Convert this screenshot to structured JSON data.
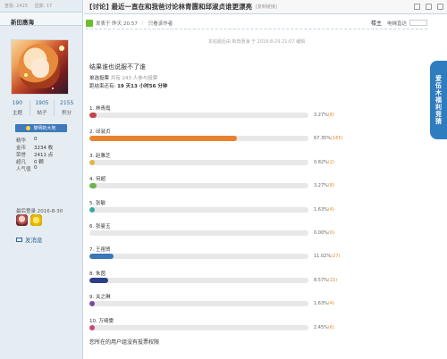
{
  "left_header": {
    "views_label": "查看: 2425",
    "replies_label": "回复: 17"
  },
  "user": {
    "name": "新田惠海",
    "stats": [
      {
        "value": "190",
        "label": "主题"
      },
      {
        "value": "1905",
        "label": "帖子"
      },
      {
        "value": "2155",
        "label": "积分"
      }
    ],
    "badge": "黎明的大地",
    "info": [
      {
        "key": "精华",
        "value": "0"
      },
      {
        "key": "金币",
        "value": "3234 枚"
      },
      {
        "key": "荣誉",
        "value": "2411 点"
      },
      {
        "key": "超凡",
        "value": "0 颗"
      },
      {
        "key": "人气值",
        "value": "0"
      }
    ],
    "last_visit": "最后登录  2016-8-30",
    "pm_label": "发消息"
  },
  "thread": {
    "title": "[讨论] 最近一直在和我爸讨论林青霞和邱淑贞谁更漂亮",
    "copy_link": "[复制链接]",
    "posted": "发表于 昨天 20:57",
    "only_author": "只看该作者",
    "floor": "楼主",
    "jump_label": "电梯直达",
    "edited": "本帖最后由 新田惠海 于 2016-8-29 21:07 编辑",
    "body": "结果谁也说服不了谁"
  },
  "poll": {
    "type_label": "单选投票",
    "voters_text": "共有 243 人参与投票",
    "deadline_prefix": "距结束还有:",
    "deadline_value": "19 天13 小时56 分钟",
    "options": [
      {
        "label": "1. 林青霞",
        "percent": 3.27,
        "percent_text": "3.27%",
        "count": "(8)",
        "color": "#c2454a"
      },
      {
        "label": "2. 邱淑贞",
        "percent": 67.35,
        "percent_text": "67.35%",
        "count": "(165)",
        "color": "#e8822e"
      },
      {
        "label": "3. 赵雅芝",
        "percent": 0.82,
        "percent_text": "0.82%",
        "count": "(2)",
        "color": "#e0b63a"
      },
      {
        "label": "4. 何超",
        "percent": 3.27,
        "percent_text": "3.27%",
        "count": "(8)",
        "color": "#6ab64b"
      },
      {
        "label": "5. 张敏",
        "percent": 1.63,
        "percent_text": "1.63%",
        "count": "(4)",
        "color": "#3aa6a0"
      },
      {
        "label": "6. 张曼玉",
        "percent": 0.0,
        "percent_text": "0.00%",
        "count": "(0)",
        "color": "#4fb0c8"
      },
      {
        "label": "7. 王祖贤",
        "percent": 11.02,
        "percent_text": "11.02%",
        "count": "(27)",
        "color": "#3a76b8"
      },
      {
        "label": "8. 朱茵",
        "percent": 8.57,
        "percent_text": "8.57%",
        "count": "(21)",
        "color": "#2d3f8a"
      },
      {
        "label": "9. 关之琳",
        "percent": 1.63,
        "percent_text": "1.63%",
        "count": "(4)",
        "color": "#7a4aa0"
      },
      {
        "label": "10. 万绮雯",
        "percent": 2.45,
        "percent_text": "2.45%",
        "count": "(6)",
        "color": "#c24a7a"
      }
    ],
    "no_permission": "您所在的用户组没有投票权限"
  },
  "side_tab": "爱伍木福利竞猜"
}
